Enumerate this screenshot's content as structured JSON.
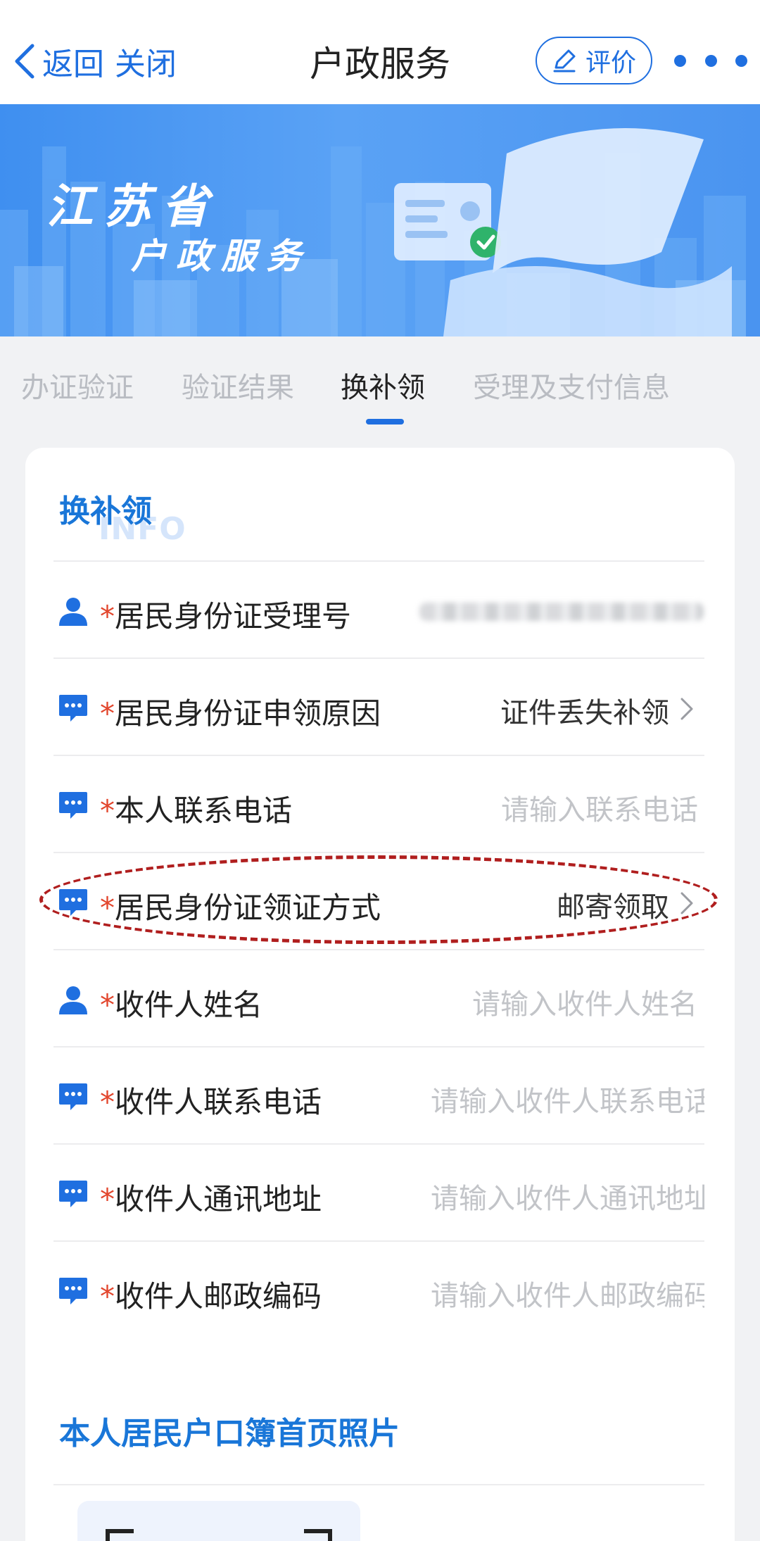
{
  "nav": {
    "back_label": "返回",
    "close_label": "关闭",
    "title": "户政服务",
    "rate_label": "评价"
  },
  "banner": {
    "title_line1": "江苏省",
    "title_line2": "户政服务"
  },
  "tabs": [
    {
      "label": "办证验证",
      "active": false
    },
    {
      "label": "验证结果",
      "active": false
    },
    {
      "label": "换补领",
      "active": true
    },
    {
      "label": "受理及支付信息",
      "active": false
    }
  ],
  "form": {
    "section_title": "换补领",
    "section_watermark": "INFO",
    "required_mark": "*",
    "rows": [
      {
        "label": "居民身份证受理号",
        "icon": "person-icon",
        "value": "",
        "placeholder": "",
        "chevron": false
      },
      {
        "label": "居民身份证申领原因",
        "icon": "chat-icon",
        "value": "证件丢失补领",
        "placeholder": "",
        "chevron": true
      },
      {
        "label": "本人联系电话",
        "icon": "chat-icon",
        "value": "",
        "placeholder": "请输入联系电话",
        "chevron": false
      },
      {
        "label": "居民身份证领证方式",
        "icon": "chat-icon",
        "value": "邮寄领取",
        "placeholder": "",
        "chevron": true
      },
      {
        "label": "收件人姓名",
        "icon": "person-icon",
        "value": "",
        "placeholder": "请输入收件人姓名",
        "chevron": false
      },
      {
        "label": "收件人联系电话",
        "icon": "chat-icon",
        "value": "",
        "placeholder": "请输入收件人联系电话",
        "chevron": false
      },
      {
        "label": "收件人通讯地址",
        "icon": "chat-icon",
        "value": "",
        "placeholder": "请输入收件人通讯地址",
        "chevron": false
      },
      {
        "label": "收件人邮政编码",
        "icon": "chat-icon",
        "value": "",
        "placeholder": "请输入收件人邮政编码",
        "chevron": false
      }
    ],
    "photo_section_title": "本人居民户口簿首页照片"
  },
  "colors": {
    "accent": "#1f6fe0",
    "section_title": "#1976d8",
    "required": "#e2462d",
    "highlight": "#b01e1e"
  }
}
